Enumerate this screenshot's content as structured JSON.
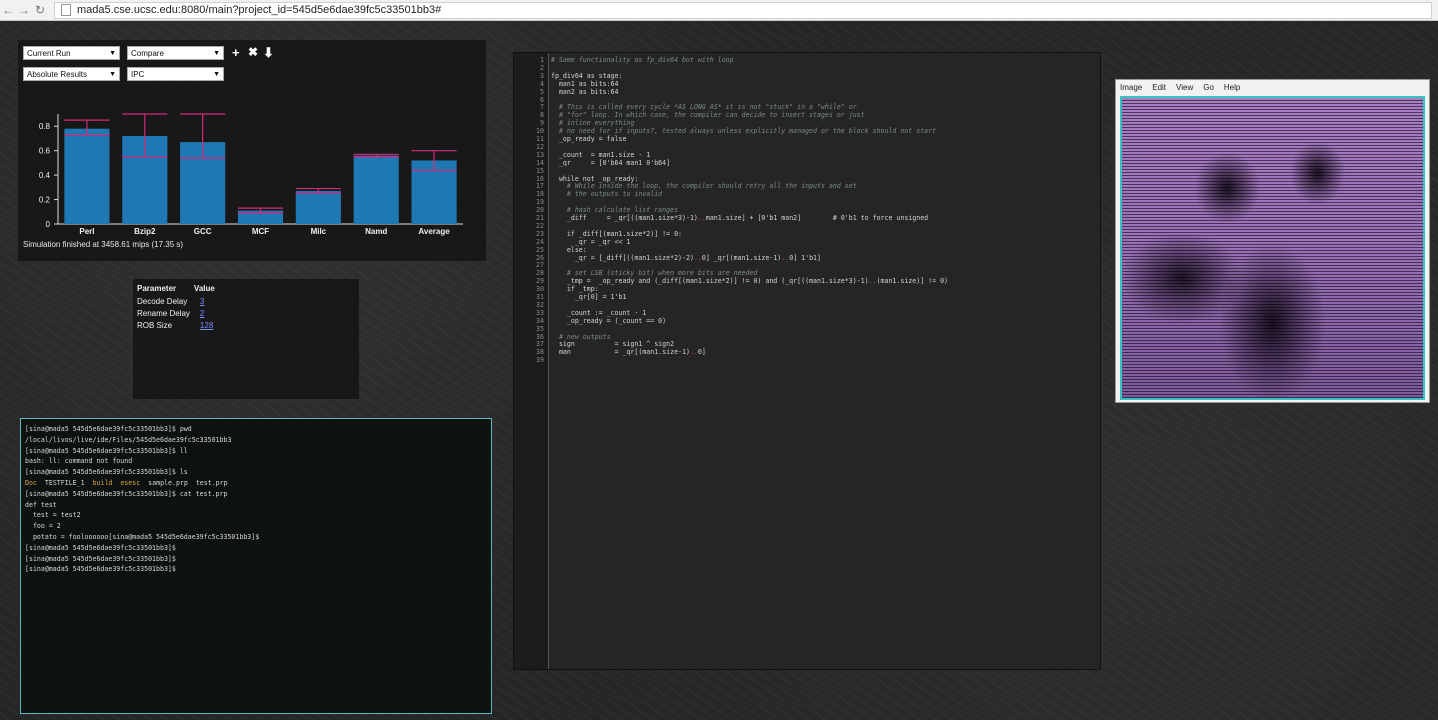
{
  "browser": {
    "url": "mada5.cse.ucsc.edu:8080/main?project_id=545d5e6dae39fc5c33501bb3#"
  },
  "controls": {
    "run_select": "Current Run",
    "compare_select": "Compare",
    "results_select": "Absolute Results",
    "metric_select": "IPC",
    "add_icon": "+",
    "close_icon": "✖",
    "download_icon": "⬇"
  },
  "chart_data": {
    "type": "bar",
    "categories": [
      "Perl",
      "Bzip2",
      "GCC",
      "MCF",
      "Milc",
      "Namd",
      "Average"
    ],
    "values": [
      0.78,
      0.72,
      0.67,
      0.11,
      0.27,
      0.56,
      0.52
    ],
    "error_low": [
      0.73,
      0.55,
      0.54,
      0.09,
      0.25,
      0.55,
      0.44
    ],
    "error_high": [
      0.85,
      0.9,
      0.9,
      0.13,
      0.29,
      0.57,
      0.6
    ],
    "ylim": [
      0,
      0.9
    ],
    "yticks": [
      "0",
      "0.2",
      "0.4",
      "0.6",
      "0.8"
    ],
    "bar_color": "#1f77b4",
    "error_color": "#d62a7a"
  },
  "sim_status": "Simulation finished at 3458.61 mips (17.35 s)",
  "params": {
    "header_param": "Parameter",
    "header_value": "Value",
    "rows": [
      {
        "name": "Decode Delay",
        "value": "3"
      },
      {
        "name": "Rename Delay",
        "value": "2"
      },
      {
        "name": "ROB Size",
        "value": "128"
      }
    ]
  },
  "terminal": [
    "[sina@mada5 545d5e6dae39fc5c33501bb3]$ pwd",
    "/local/livos/live/ide/Files/545d5e6dae39fc5c33501bb3",
    "[sina@mada5 545d5e6dae39fc5c33501bb3]$ ll",
    "bash: ll: command not found",
    "[sina@mada5 545d5e6dae39fc5c33501bb3]$ ls",
    "Doc  TESTFILE_1  build  esesc  sample.prp  test.prp",
    "[sina@mada5 545d5e6dae39fc5c33501bb3]$ cat test.prp",
    "def test",
    "  test = test2",
    "  foo = 2",
    "  potato = fooloooooo[sina@mada5 545d5e6dae39fc5c33501bb3]$",
    "[sina@mada5 545d5e6dae39fc5c33501bb3]$",
    "[sina@mada5 545d5e6dae39fc5c33501bb3]$",
    "[sina@mada5 545d5e6dae39fc5c33501bb3]$"
  ],
  "code": [
    "# Same functionality as fp_div64 but with loop",
    "",
    "fp_div64 as stage:",
    "  man1 as bits:64",
    "  man2 as bits:64",
    "",
    "  # This is called every cycle *AS LONG AS* it is not \"stuck\" in a \"while\" or",
    "  # \"for\" loop. In which case, the compiler can decide to insert stages or just",
    "  # inline everything",
    "  # no need for if inputs?, tested always unless explicitly managed or the block should not start",
    "  _op_ready = false",
    "",
    "  _count  = man1.size - 1",
    "  _qr     = [0'b64 man1 0'b64]",
    "",
    "  while not _op_ready:",
    "    # While inside the loop, the compiler should retry all the inputs and set",
    "    # the outputs to invalid",
    "",
    "    # hash calculate list ranges",
    "    _diff     = _qr[((man1.size*3)-1)..man1.size] + [0'b1 man2]        # 0'b1 to force unsigned",
    "",
    "    if _diff[(man1.size*2)] != 0:",
    "      _qr = _qr << 1",
    "    else:",
    "      _qr = [_diff[((man1.size*2)-2)..0] _qr[(man1.size-1)..0] 1'b1]",
    "",
    "    # set LSB (sticky bit) when more bits are needed",
    "    _tmp =  _op_ready and (_diff[(man1.size*2)] != 0) and (_qr[((man1.size*3)-1)..(man1.size)] != 0)",
    "    if _tmp:",
    "      _qr[0] = 1'b1",
    "",
    "    _count := _count - 1",
    "    _op_ready = (_count == 0)",
    "",
    "  # new outputs",
    "  sign          = sign1 ^ sign2",
    "  man           = _qr[(man1.size-1)..0]",
    ""
  ],
  "viewer_menu": [
    "Image",
    "Edit",
    "View",
    "Go",
    "Help"
  ]
}
